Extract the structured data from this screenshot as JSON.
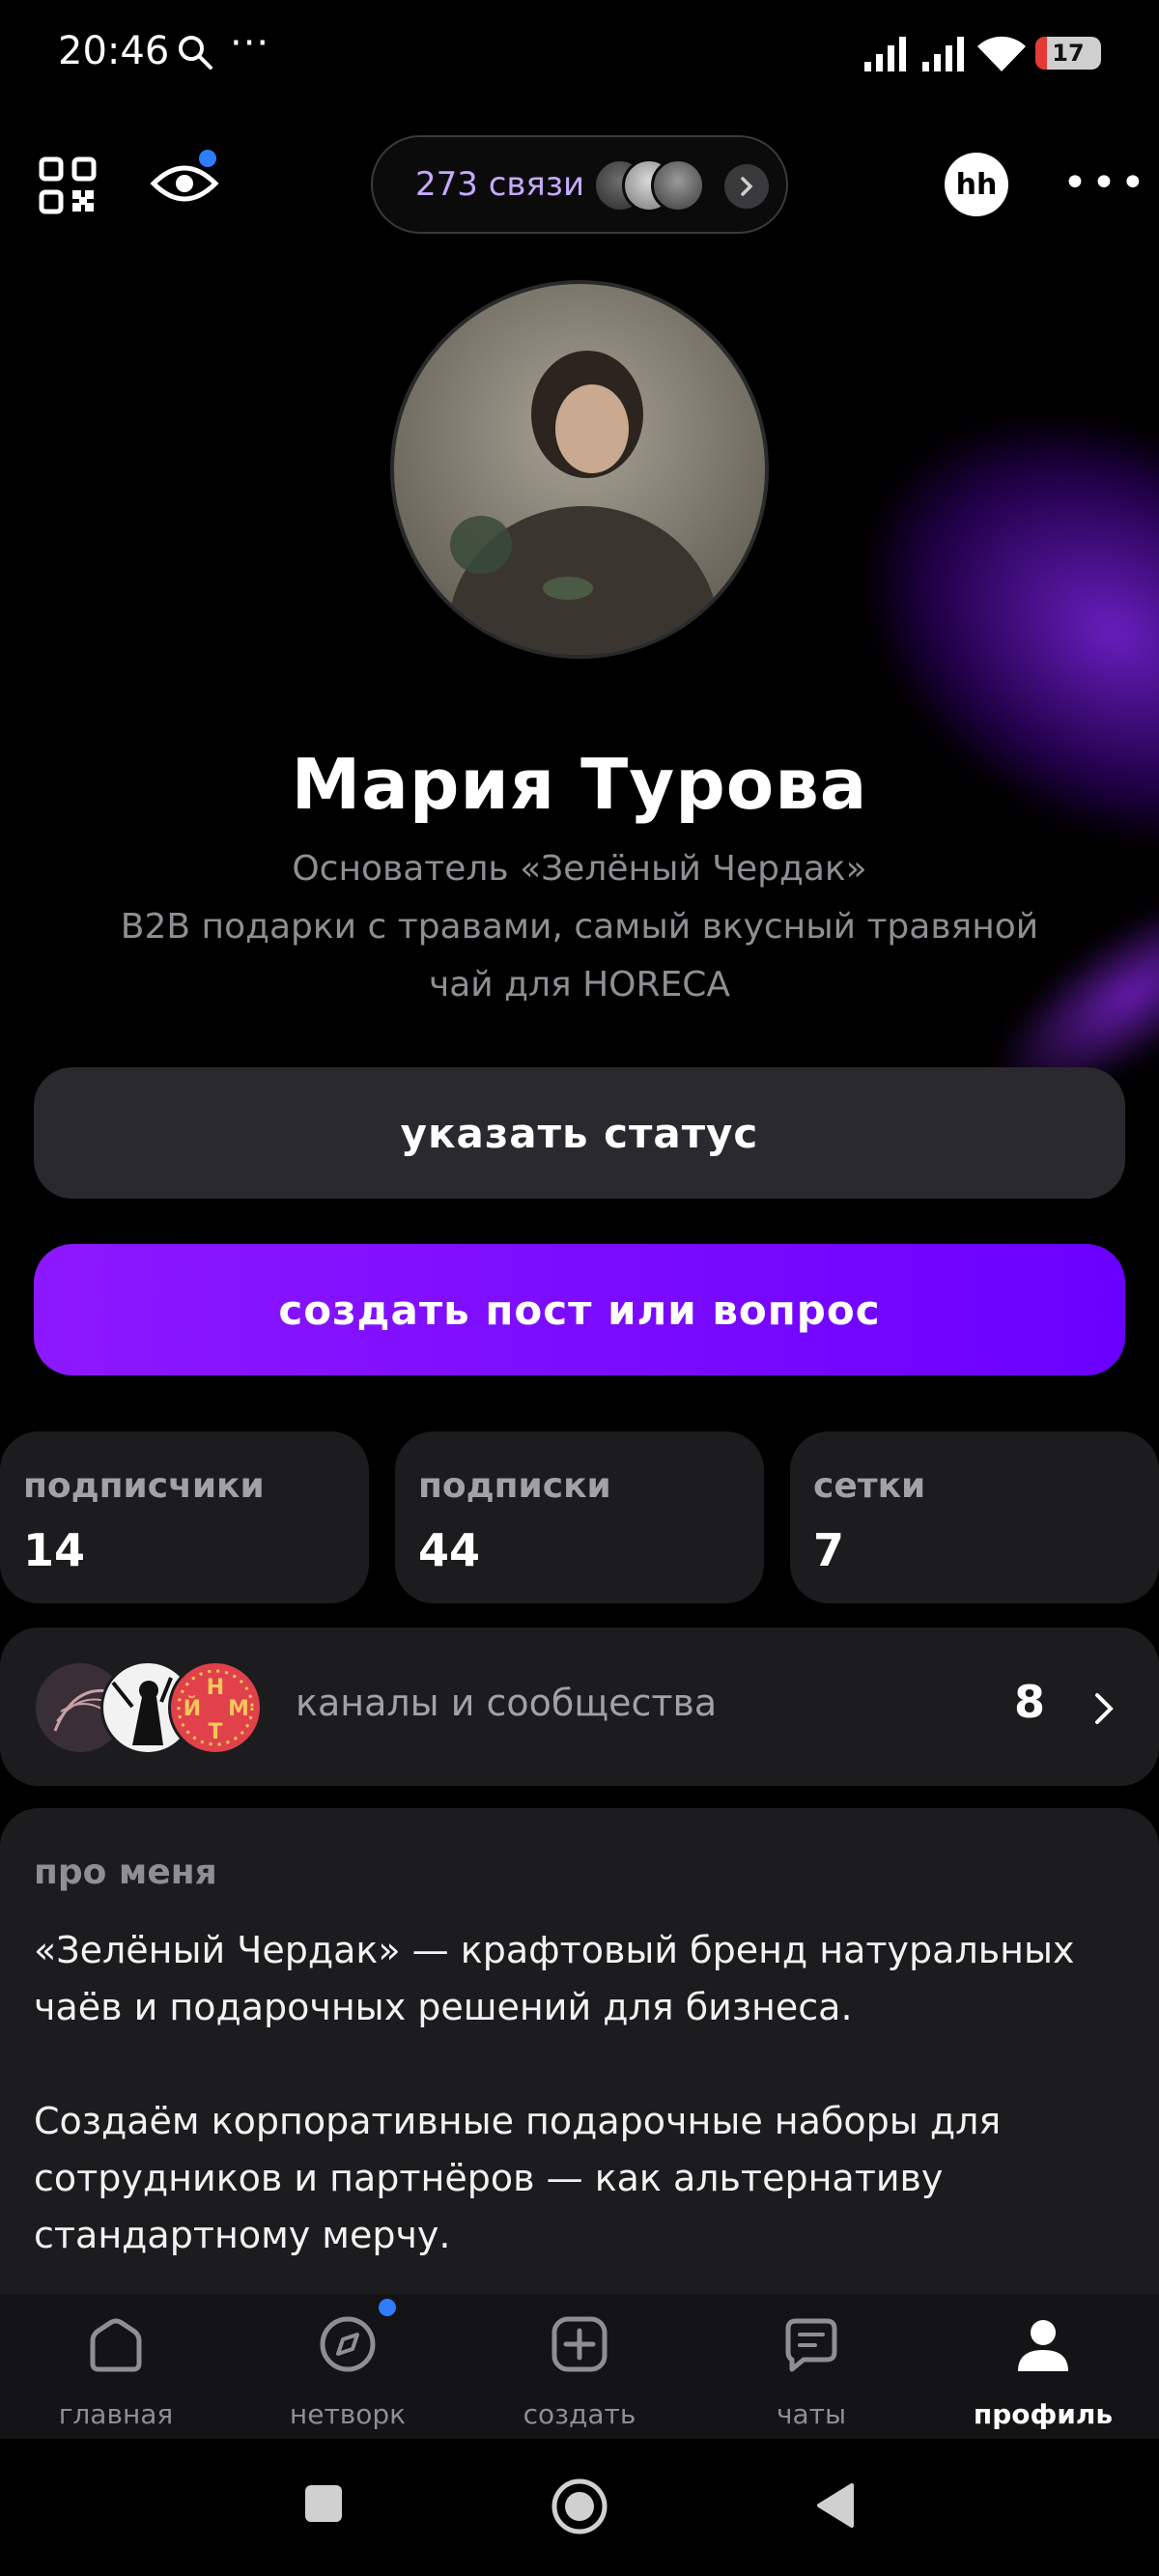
{
  "status_bar": {
    "time": "20:46",
    "overflow": "···",
    "battery": "17",
    "icons": [
      "search-icon",
      "signal-icon",
      "signal-icon",
      "wifi-icon",
      "battery-icon"
    ]
  },
  "top_bar": {
    "connections_label": "273 связи",
    "hh_label": "hh",
    "more": "•••"
  },
  "profile": {
    "name": "Мария Турова",
    "headline_lines": [
      "Основатель «Зелёный Чердак»",
      "B2B подарки с травами, самый вкусный травяной",
      "чай для HORECA"
    ]
  },
  "buttons": {
    "status": "указать статус",
    "create": "создать пост или вопрос"
  },
  "stats": [
    {
      "label": "подписчики",
      "value": "14"
    },
    {
      "label": "подписки",
      "value": "44"
    },
    {
      "label": "сетки",
      "value": "7"
    }
  ],
  "channels": {
    "label": "каналы и сообщества",
    "count": "8",
    "badge_letters": [
      "Н",
      "Й",
      "М",
      "Т"
    ]
  },
  "about": {
    "title": "про меня",
    "paragraph1": "«Зелёный Чердак» — крафтовый бренд натуральных чаёв и подарочных решений для бизнеса.",
    "paragraph2": "Создаём корпоративные подарочные наборы для сотрудников и партнёров — как альтернативу стандартному мерчу."
  },
  "nav": {
    "items": [
      {
        "label": "главная",
        "icon": "home-icon"
      },
      {
        "label": "нетворк",
        "icon": "compass-icon"
      },
      {
        "label": "создать",
        "icon": "plus-square-icon"
      },
      {
        "label": "чаты",
        "icon": "chat-icon"
      },
      {
        "label": "профиль",
        "icon": "profile-icon"
      }
    ],
    "active": "профиль"
  },
  "colors": {
    "accent": "#7b12ff",
    "connections_text": "#c5a9ff",
    "notification_dot": "#2f7cff",
    "card_bg": "#1c1c1e"
  }
}
